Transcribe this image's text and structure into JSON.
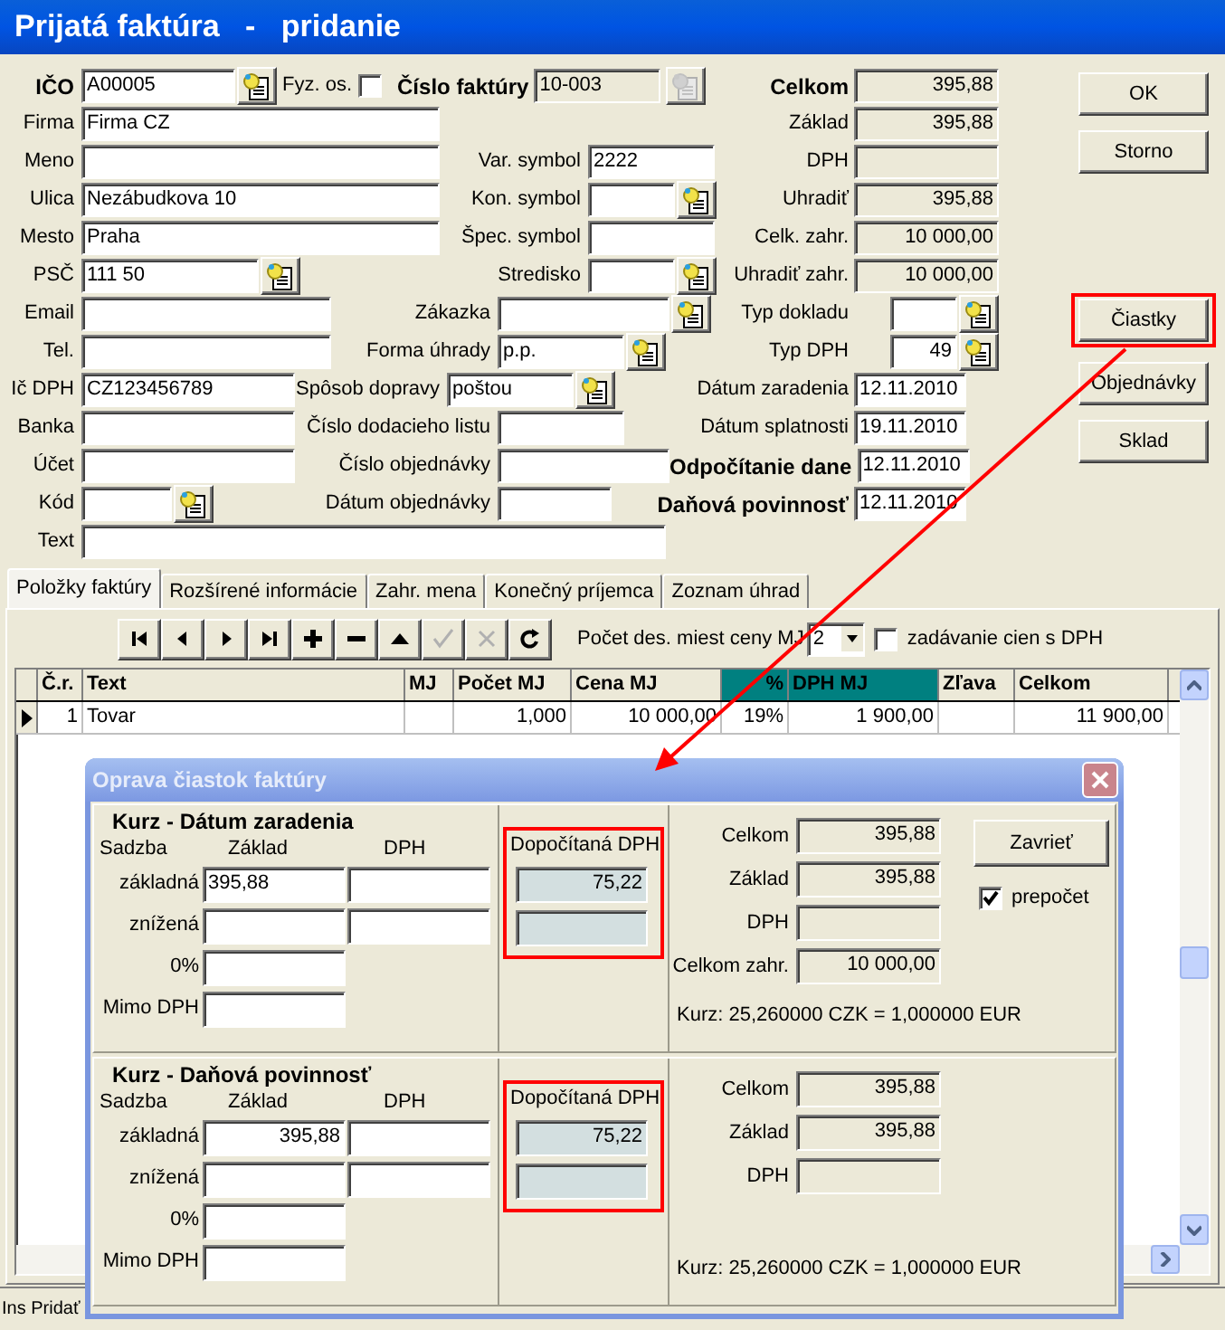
{
  "window": {
    "title": "Prijatá faktúra   -   pridanie"
  },
  "left_fields": [
    {
      "label": "IČO",
      "value": "A00005",
      "kind": "lookup",
      "bold": true
    },
    {
      "label": "Firma",
      "value": "Firma CZ",
      "kind": "text",
      "bold": false
    },
    {
      "label": "Meno",
      "kind": "text",
      "bold": false
    },
    {
      "label": "Ulica",
      "value": "Nezábudkova 10",
      "kind": "text",
      "bold": false
    },
    {
      "label": "Mesto",
      "value": "Praha",
      "kind": "text",
      "bold": false
    },
    {
      "label": "PSČ",
      "value": "111 50",
      "kind": "lookup",
      "bold": false
    },
    {
      "label": "Email",
      "kind": "text",
      "bold": false
    },
    {
      "label": "Tel.",
      "kind": "text",
      "bold": false
    },
    {
      "label": "Ič DPH",
      "value": "CZ123456789",
      "kind": "text",
      "bold": false
    },
    {
      "label": "Banka",
      "kind": "text",
      "bold": false
    },
    {
      "label": "Účet",
      "kind": "text",
      "bold": false
    },
    {
      "label": "Kód",
      "kind": "lookup",
      "bold": false
    },
    {
      "label": "Text",
      "kind": "text",
      "bold": false
    }
  ],
  "person_checkbox": {
    "label": "Fyz. os.",
    "checked": false
  },
  "invoice_number": {
    "label": "Číslo faktúry",
    "value": "10-003",
    "disabled": true
  },
  "middle_fields": [
    {
      "label": "Var. symbol",
      "value": "2222",
      "kind": "text"
    },
    {
      "label": "Kon. symbol",
      "kind": "lookup"
    },
    {
      "label": "Špec. symbol",
      "kind": "text"
    },
    {
      "label": "Stredisko",
      "kind": "lookup"
    },
    {
      "label": "Zákazka",
      "kind": "lookup"
    },
    {
      "label": "Forma úhrady",
      "value": "p.p.",
      "kind": "lookup"
    },
    {
      "label": "Spôsob dopravy",
      "value": "poštou",
      "kind": "lookup"
    },
    {
      "label": "Číslo dodacieho listu",
      "kind": "text"
    },
    {
      "label": "Číslo objednávky",
      "kind": "text"
    },
    {
      "label": "Dátum objednávky",
      "kind": "text"
    }
  ],
  "right_fields": [
    {
      "label": "Celkom",
      "value": "395,88",
      "kind": "amount",
      "bold": true
    },
    {
      "label": "Základ",
      "value": "395,88",
      "kind": "amount",
      "bold": false
    },
    {
      "label": "DPH",
      "kind": "amount",
      "bold": false
    },
    {
      "label": "Uhradiť",
      "value": "395,88",
      "kind": "amount",
      "bold": false
    },
    {
      "label": "Celk. zahr.",
      "value": "10 000,00",
      "kind": "amount",
      "bold": false
    },
    {
      "label": "Uhradiť zahr.",
      "value": "10 000,00",
      "kind": "amount",
      "bold": false
    },
    {
      "label": "Typ dokladu",
      "kind": "lookup",
      "bold": false
    },
    {
      "label": "Typ DPH",
      "value": "49",
      "kind": "lookup",
      "bold": false
    },
    {
      "label": "Dátum zaradenia",
      "value": "12.11.2010",
      "kind": "date",
      "bold": false
    },
    {
      "label": "Dátum splatnosti",
      "value": "19.11.2010",
      "kind": "date",
      "bold": false
    },
    {
      "label": "Odpočítanie dane",
      "value": "12.11.2010",
      "kind": "date",
      "bold": true
    },
    {
      "label": "Daňová povinnosť",
      "value": "12.11.2010",
      "kind": "date",
      "bold": true
    }
  ],
  "buttons": [
    {
      "label": "OK",
      "highlighted": false
    },
    {
      "label": "Storno",
      "highlighted": false
    },
    {
      "label": "Čiastky",
      "highlighted": true
    },
    {
      "label": "Objednávky",
      "highlighted": false
    },
    {
      "label": "Sklad",
      "highlighted": false
    }
  ],
  "tabs": [
    {
      "label": "Položky faktúry",
      "selected": true
    },
    {
      "label": "Rozšírené informácie",
      "selected": false
    },
    {
      "label": "Zahr. mena",
      "selected": false
    },
    {
      "label": "Konečný príjemca",
      "selected": false
    },
    {
      "label": "Zoznam úhrad",
      "selected": false
    }
  ],
  "toolbar": [
    {
      "kind": "first",
      "disabled": false
    },
    {
      "kind": "prev",
      "disabled": false
    },
    {
      "kind": "next",
      "disabled": false
    },
    {
      "kind": "last",
      "disabled": false
    },
    {
      "kind": "add",
      "disabled": false
    },
    {
      "kind": "remove",
      "disabled": false
    },
    {
      "kind": "up",
      "disabled": false
    },
    {
      "kind": "confirm",
      "disabled": true
    },
    {
      "kind": "cancel",
      "disabled": true
    },
    {
      "kind": "refresh",
      "disabled": false
    }
  ],
  "decimals": {
    "label": "Počet des. miest ceny MJ",
    "value": "2"
  },
  "vat_prices_checkbox": {
    "label": "zadávanie cien s DPH",
    "checked": false
  },
  "table": {
    "columns": [
      {
        "label": "Č.r.",
        "highlighted": false
      },
      {
        "label": "Text",
        "highlighted": false
      },
      {
        "label": "MJ",
        "highlighted": false
      },
      {
        "label": "Počet MJ",
        "highlighted": false
      },
      {
        "label": "Cena MJ",
        "highlighted": false
      },
      {
        "label": "%",
        "highlighted": true
      },
      {
        "label": "DPH MJ",
        "highlighted": true
      },
      {
        "label": "Zľava",
        "highlighted": false
      },
      {
        "label": "Celkom",
        "highlighted": false
      }
    ],
    "rows": [
      {
        "current": true,
        "cells": [
          "1",
          "Tovar",
          null,
          "1,000",
          "10 000,00",
          "19%",
          "1 900,00",
          null,
          "11 900,00"
        ]
      }
    ]
  },
  "status_bar": {
    "text": "Ins Pridať"
  },
  "dialog": {
    "title": "Oprava čiastok faktúry",
    "close_button": true,
    "close_label": "Zavrieť",
    "recalc_checkbox": {
      "label": "prepočet",
      "checked": true
    },
    "sections": [
      {
        "heading": "Kurz - Dátum zaradenia",
        "editing": true,
        "headers": [
          "Sadzba",
          "Základ",
          "DPH"
        ],
        "rates": [
          {
            "label": "základná",
            "kind": "pair",
            "base": "395,88"
          },
          {
            "label": "znížená",
            "kind": "pair"
          },
          {
            "label": "0%",
            "kind": "single"
          },
          {
            "label": "Mimo DPH",
            "kind": "single"
          }
        ],
        "computed": {
          "label": "Dopočítaná DPH",
          "value": "75,22"
        },
        "totals": [
          {
            "label": "Celkom",
            "value": "395,88"
          },
          {
            "label": "Základ",
            "value": "395,88"
          },
          {
            "label": "DPH"
          },
          {
            "label": "Celkom zahr.",
            "value": "10 000,00"
          }
        ],
        "rate_text": "Kurz: 25,260000 CZK = 1,000000 EUR"
      },
      {
        "heading": "Kurz - Daňová povinnosť",
        "editing": false,
        "headers": [
          "Sadzba",
          "Základ",
          "DPH"
        ],
        "rates": [
          {
            "label": "základná",
            "kind": "pair",
            "base": "395,88"
          },
          {
            "label": "znížená",
            "kind": "pair"
          },
          {
            "label": "0%",
            "kind": "single"
          },
          {
            "label": "Mimo DPH",
            "kind": "single"
          }
        ],
        "computed": {
          "label": "Dopočítaná DPH",
          "value": "75,22"
        },
        "totals": [
          {
            "label": "Celkom",
            "value": "395,88"
          },
          {
            "label": "Základ",
            "value": "395,88"
          },
          {
            "label": "DPH"
          }
        ],
        "rate_text": "Kurz: 25,260000 CZK = 1,000000 EUR"
      }
    ]
  }
}
